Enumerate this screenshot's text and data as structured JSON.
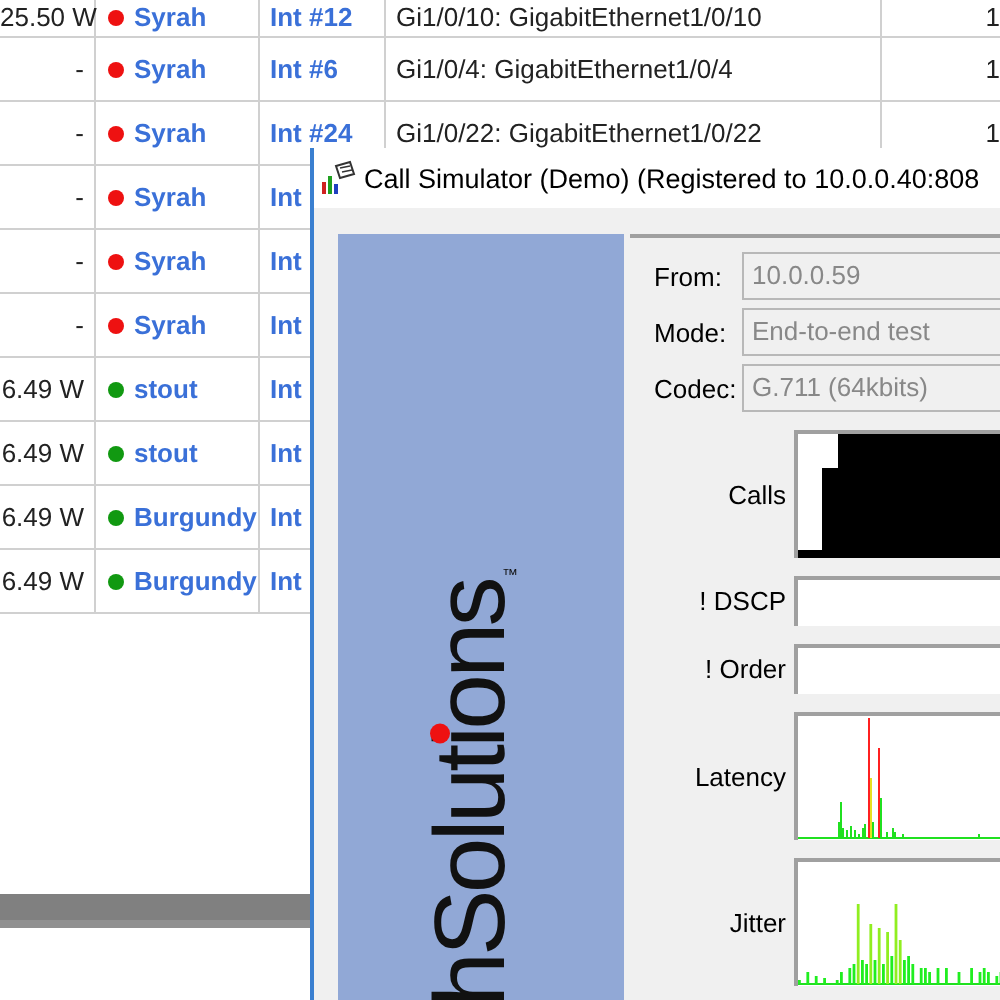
{
  "table": {
    "rows": [
      {
        "power": "25.50 W",
        "color": "#ee1111",
        "device": "Syrah",
        "interface": "Int #12",
        "port": "Gi1/0/10: GigabitEthernet1/0/10",
        "column_5": "1"
      },
      {
        "power": "-",
        "color": "#ee1111",
        "device": "Syrah",
        "interface": "Int #6",
        "port": "Gi1/0/4: GigabitEthernet1/0/4",
        "column_5": "1"
      },
      {
        "power": "-",
        "color": "#ee1111",
        "device": "Syrah",
        "interface": "Int #24",
        "port": "Gi1/0/22: GigabitEthernet1/0/22",
        "column_5": "1"
      },
      {
        "power": "-",
        "color": "#ee1111",
        "device": "Syrah",
        "interface": "Int"
      },
      {
        "power": "-",
        "color": "#ee1111",
        "device": "Syrah",
        "interface": "Int"
      },
      {
        "power": "-",
        "color": "#ee1111",
        "device": "Syrah",
        "interface": "Int"
      },
      {
        "power": "6.49 W",
        "color": "#119911",
        "device": "stout",
        "interface": "Int"
      },
      {
        "power": "6.49 W",
        "color": "#119911",
        "device": "stout",
        "interface": "Int"
      },
      {
        "power": "6.49 W",
        "color": "#119911",
        "device": "Burgundy",
        "interface": "Int"
      },
      {
        "power": "6.49 W",
        "color": "#119911",
        "device": "Burgundy",
        "interface": "Int"
      }
    ]
  },
  "dialog": {
    "title": "Call Simulator (Demo) (Registered to 10.0.0.40:808",
    "logo_text": "hSolutions",
    "logo_mark": "™",
    "fields": [
      {
        "label": "From:",
        "value": "10.0.0.59"
      },
      {
        "label": "Mode:",
        "value": "End-to-end test"
      },
      {
        "label": "Codec:",
        "value": "G.711 (64kbits)"
      }
    ],
    "monitors": [
      {
        "label": "Calls",
        "kind": "calls"
      },
      {
        "label": "! DSCP",
        "kind": "empty"
      },
      {
        "label": "! Order",
        "kind": "empty"
      },
      {
        "label": "Latency",
        "kind": "latency"
      },
      {
        "label": "Jitter",
        "kind": "jitter"
      }
    ]
  }
}
